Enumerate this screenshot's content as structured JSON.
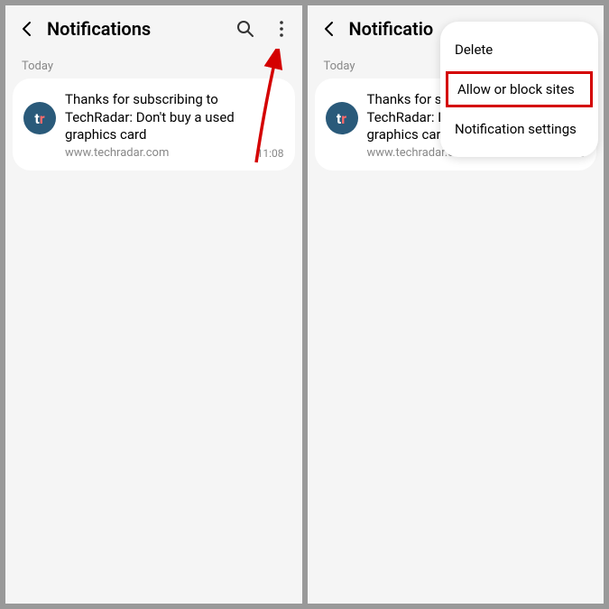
{
  "header": {
    "title": "Notifications"
  },
  "section": {
    "label": "Today"
  },
  "notification": {
    "avatar_t": "t",
    "avatar_r": "r",
    "title": "Thanks for subscribing to TechRadar: Don't buy a used graphics card",
    "source": "www.techradar.com",
    "time": "11:08"
  },
  "partial_title": "Notificatio",
  "menu": {
    "delete": "Delete",
    "allow_block": "Allow or block sites",
    "settings": "Notification settings"
  }
}
